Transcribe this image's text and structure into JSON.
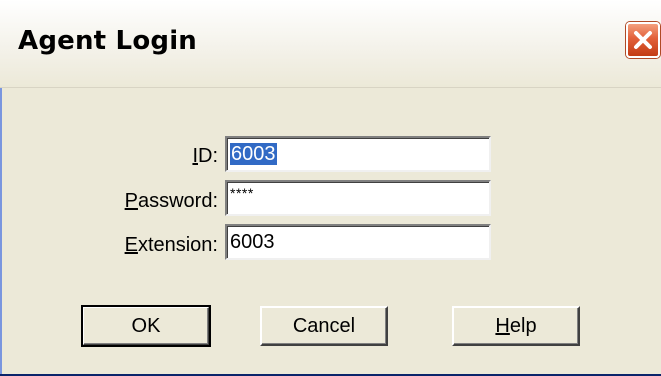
{
  "window": {
    "title": "Agent Login",
    "close_icon": "close-icon"
  },
  "fields": {
    "id": {
      "label_mnemonic": "I",
      "label_rest": "D:",
      "value": "6003",
      "selected": true
    },
    "password": {
      "label_mnemonic": "P",
      "label_rest": "assword:",
      "value": "****"
    },
    "extension": {
      "label_mnemonic": "E",
      "label_rest": "xtension:",
      "value": "6003"
    }
  },
  "buttons": {
    "ok": {
      "label": "OK"
    },
    "cancel": {
      "label": "Cancel"
    },
    "help": {
      "label_mnemonic": "H",
      "label_rest": "elp"
    }
  },
  "colors": {
    "face": "#ece9d8",
    "selection": "#316ac5",
    "close": "#e2603a"
  }
}
